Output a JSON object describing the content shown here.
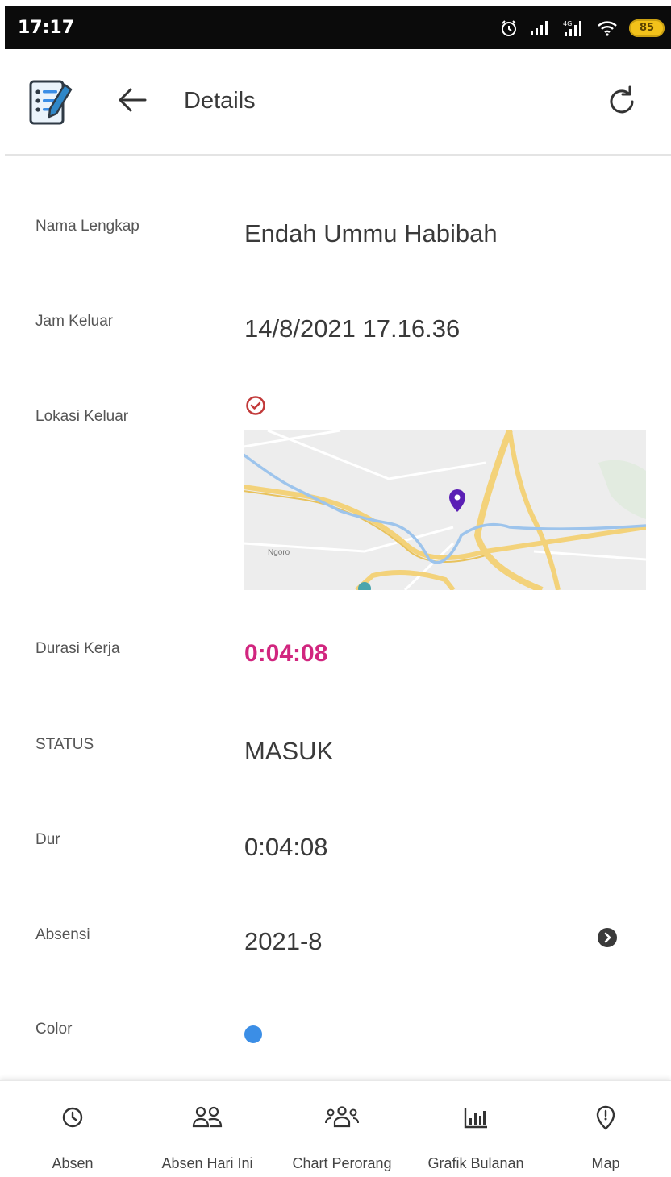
{
  "status_bar": {
    "time": "17:17",
    "battery": "85",
    "icons": [
      "alarm-icon",
      "signal-icon",
      "4g-signal-icon",
      "wifi-icon",
      "battery-icon"
    ]
  },
  "app_bar": {
    "title": "Details",
    "icons": [
      "app-checklist-icon",
      "back-arrow-icon",
      "refresh-icon"
    ]
  },
  "details": {
    "nama_lengkap": {
      "label": "Nama Lengkap",
      "value": "Endah Ummu Habibah"
    },
    "jam_keluar": {
      "label": "Jam Keluar",
      "value": "14/8/2021 17.16.36"
    },
    "lokasi_keluar": {
      "label": "Lokasi Keluar",
      "map_place_label": "Ngoro"
    },
    "durasi_kerja": {
      "label": "Durasi Kerja",
      "value": "0:04:08"
    },
    "status": {
      "label": "STATUS",
      "value": "MASUK"
    },
    "dur": {
      "label": "Dur",
      "value": "0:04:08"
    },
    "absensi": {
      "label": "Absensi",
      "value": "2021-8"
    },
    "color": {
      "label": "Color",
      "value": "#3b8ee6"
    }
  },
  "colors": {
    "accent_pink": "#d1267f",
    "check_red": "#c23a3a",
    "map_pin": "#5b1fb5"
  },
  "bottom_nav": [
    {
      "label": "Absen",
      "icon": "clock-icon"
    },
    {
      "label": "Absen Hari Ini",
      "icon": "users-icon"
    },
    {
      "label": "Chart Perorang",
      "icon": "group-icon"
    },
    {
      "label": "Grafik Bulanan",
      "icon": "bar-chart-icon"
    },
    {
      "label": "Map",
      "icon": "map-pin-icon"
    }
  ]
}
